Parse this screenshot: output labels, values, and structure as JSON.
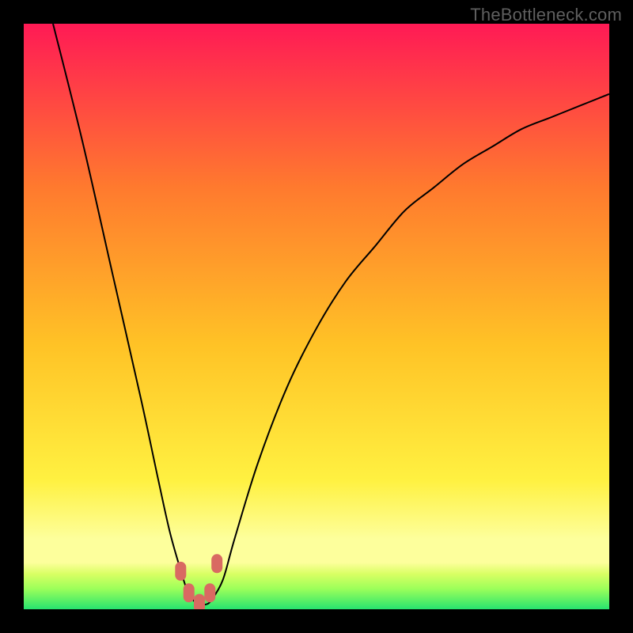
{
  "watermark": "TheBottleneck.com",
  "colors": {
    "top": "#ff1a55",
    "upper_mid": "#ff7a2e",
    "mid": "#ffc326",
    "lower_mid": "#fff141",
    "pale_yellow": "#fdff9c",
    "yellow_green": "#d8ff63",
    "light_green": "#9cff5a",
    "green": "#27e46f",
    "curve": "#000000",
    "marker": "#d96a62",
    "frame": "#000000"
  },
  "chart_data": {
    "type": "line",
    "title": "",
    "xlabel": "",
    "ylabel": "",
    "xlim": [
      0,
      100
    ],
    "ylim": [
      0,
      100
    ],
    "x": [
      5,
      10,
      15,
      20,
      23,
      25,
      27,
      28,
      29,
      30,
      31,
      32,
      34,
      36,
      40,
      45,
      50,
      55,
      60,
      65,
      70,
      75,
      80,
      85,
      90,
      95,
      100
    ],
    "values": [
      100,
      80,
      58,
      36,
      22,
      13,
      6,
      3,
      1.5,
      0.8,
      0.8,
      1.5,
      5,
      12,
      25,
      38,
      48,
      56,
      62,
      68,
      72,
      76,
      79,
      82,
      84,
      86,
      88
    ],
    "minimum_region": {
      "x_range": [
        26.5,
        33
      ],
      "y_approx": 0.8
    },
    "series": [
      {
        "name": "bottleneck-curve",
        "x": [
          5,
          10,
          15,
          20,
          23,
          25,
          27,
          28,
          29,
          30,
          31,
          32,
          34,
          36,
          40,
          45,
          50,
          55,
          60,
          65,
          70,
          75,
          80,
          85,
          90,
          95,
          100
        ],
        "values": [
          100,
          80,
          58,
          36,
          22,
          13,
          6,
          3,
          1.5,
          0.8,
          0.8,
          1.5,
          5,
          12,
          25,
          38,
          48,
          56,
          62,
          68,
          72,
          76,
          79,
          82,
          84,
          86,
          88
        ]
      }
    ],
    "markers": [
      {
        "x": 26.8,
        "y": 6.5
      },
      {
        "x": 28.2,
        "y": 2.8
      },
      {
        "x": 30.0,
        "y": 1.0
      },
      {
        "x": 31.8,
        "y": 2.8
      },
      {
        "x": 33.0,
        "y": 7.8
      }
    ]
  }
}
